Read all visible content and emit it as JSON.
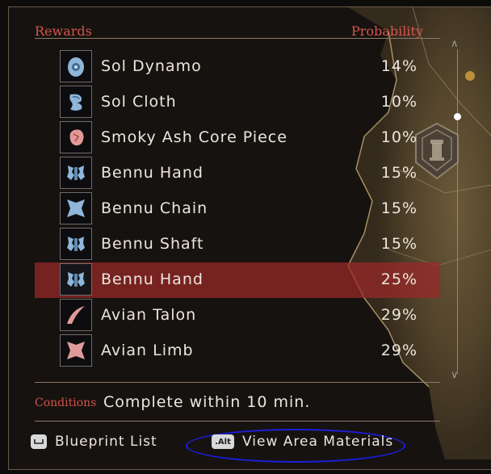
{
  "header": {
    "rewards_label": "Rewards",
    "probability_label": "Probability"
  },
  "rewards": [
    {
      "name": "Sol Dynamo",
      "probability": "14%",
      "icon": "sol-dynamo-icon",
      "selected": false
    },
    {
      "name": "Sol Cloth",
      "probability": "10%",
      "icon": "sol-cloth-icon",
      "selected": false
    },
    {
      "name": "Smoky Ash Core Piece",
      "probability": "10%",
      "icon": "ash-core-icon",
      "selected": false
    },
    {
      "name": "Bennu Hand",
      "probability": "15%",
      "icon": "bennu-hand-icon",
      "selected": false
    },
    {
      "name": "Bennu Chain",
      "probability": "15%",
      "icon": "bennu-chain-icon",
      "selected": false
    },
    {
      "name": "Bennu Shaft",
      "probability": "15%",
      "icon": "bennu-shaft-icon",
      "selected": false
    },
    {
      "name": "Bennu Hand",
      "probability": "25%",
      "icon": "bennu-hand-icon",
      "selected": true
    },
    {
      "name": "Avian Talon",
      "probability": "29%",
      "icon": "avian-talon-icon",
      "selected": false
    },
    {
      "name": "Avian Limb",
      "probability": "29%",
      "icon": "avian-limb-icon",
      "selected": false
    }
  ],
  "conditions": {
    "label": "Conditions",
    "text": "Complete within 10 min."
  },
  "buttons": {
    "blueprint_key": "",
    "blueprint_label": "Blueprint List",
    "view_area_key": ".Alt",
    "view_area_label": "View Area Materials"
  },
  "colors": {
    "accent": "#d4544c",
    "selected_row": "#9b2828",
    "highlight_oval": "#1a1fd8"
  }
}
